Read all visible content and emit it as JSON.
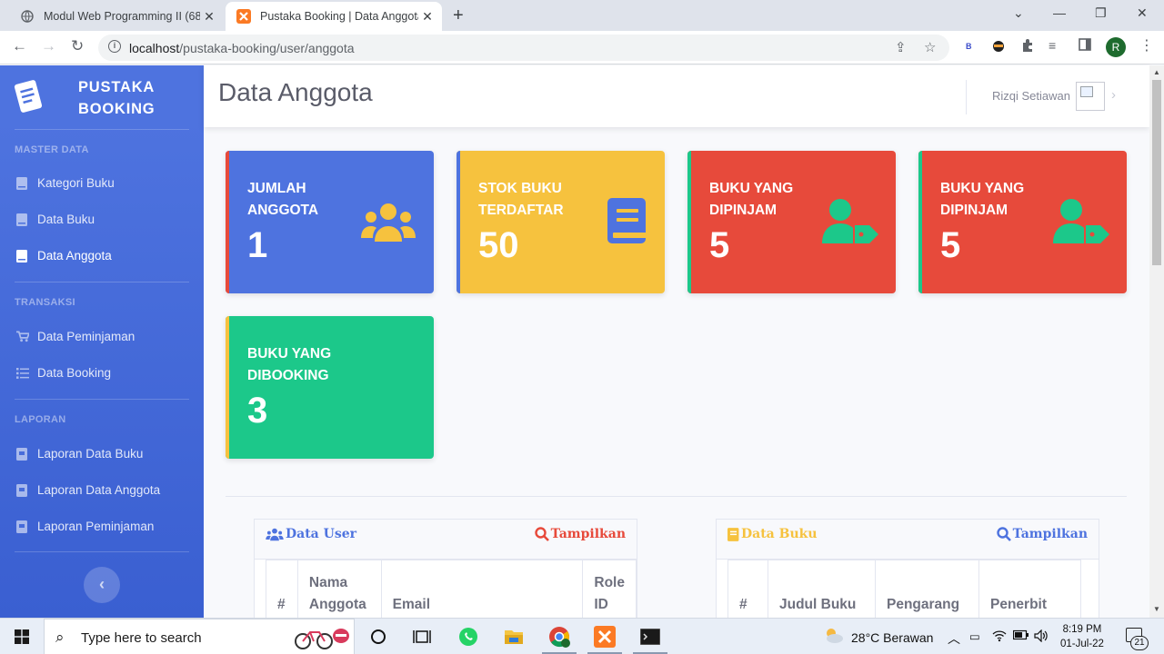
{
  "browser": {
    "tabs": [
      {
        "title": "Modul Web Programming II (682"
      },
      {
        "title": "Pustaka Booking | Data Anggota"
      }
    ],
    "new_tab_label": "+",
    "url_host": "localhost",
    "url_path": "/pustaka-booking/user/anggota",
    "profile_initial": "R",
    "ext_label": "B"
  },
  "sidebar": {
    "brand_line1": "PUSTAKA",
    "brand_line2": "BOOKING",
    "sections": [
      {
        "heading": "MASTER DATA",
        "items": [
          {
            "label": "Kategori Buku",
            "icon": "book-icon"
          },
          {
            "label": "Data Buku",
            "icon": "book-icon"
          },
          {
            "label": "Data Anggota",
            "icon": "book-icon",
            "active": true
          }
        ]
      },
      {
        "heading": "TRANSAKSI",
        "items": [
          {
            "label": "Data Peminjaman",
            "icon": "cart-icon"
          },
          {
            "label": "Data Booking",
            "icon": "list-icon"
          }
        ]
      },
      {
        "heading": "LAPORAN",
        "items": [
          {
            "label": "Laporan Data Buku",
            "icon": "report-icon"
          },
          {
            "label": "Laporan Data Anggota",
            "icon": "report-icon"
          },
          {
            "label": "Laporan Peminjaman",
            "icon": "report-icon"
          }
        ]
      }
    ],
    "toggle_label": "‹"
  },
  "topbar": {
    "title": "Data Anggota",
    "username": "Rizqi Setiawan"
  },
  "cards": [
    {
      "label_line1": "JUMLAH",
      "label_line2": "ANGGOTA",
      "value": "1",
      "color": "#4e73df",
      "icon": "users-icon"
    },
    {
      "label_line1": "STOK BUKU",
      "label_line2": "TERDAFTAR",
      "value": "50",
      "color": "#f6c23e",
      "icon": "book-icon"
    },
    {
      "label_line1": "BUKU YANG",
      "label_line2": "DIPINJAM",
      "value": "5",
      "color": "#e74a3b",
      "icon": "user-tag-icon"
    },
    {
      "label_line1": "BUKU YANG",
      "label_line2": "DIPINJAM",
      "value": "5",
      "color": "#e74a3b",
      "icon": "user-tag-icon"
    },
    {
      "label_line1": "BUKU YANG",
      "label_line2": "DIBOOKING",
      "value": "3",
      "color": "#1cc88a",
      "icon": "none"
    }
  ],
  "panels": {
    "user": {
      "title": "Data User",
      "action": "Tampilkan",
      "title_color": "#4e73df",
      "action_color": "#e74a3b",
      "columns": [
        {
          "line1": "",
          "line2": "#"
        },
        {
          "line1": "Nama",
          "line2": "Anggota"
        },
        {
          "line1": "",
          "line2": "Email"
        },
        {
          "line1": "Role",
          "line2": "ID"
        }
      ]
    },
    "buku": {
      "title": "Data Buku",
      "action": "Tampilkan",
      "title_color": "#f6c23e",
      "action_color": "#4e73df",
      "columns": [
        {
          "line1": "",
          "line2": "#"
        },
        {
          "line1": "",
          "line2": "Judul Buku"
        },
        {
          "line1": "",
          "line2": "Pengarang"
        },
        {
          "line1": "",
          "line2": "Penerbit"
        }
      ]
    }
  },
  "taskbar": {
    "search_placeholder": "Type here to search",
    "weather": "28°C  Berawan",
    "time": "8:19 PM",
    "date": "01-Jul-22",
    "notifications": "21"
  }
}
